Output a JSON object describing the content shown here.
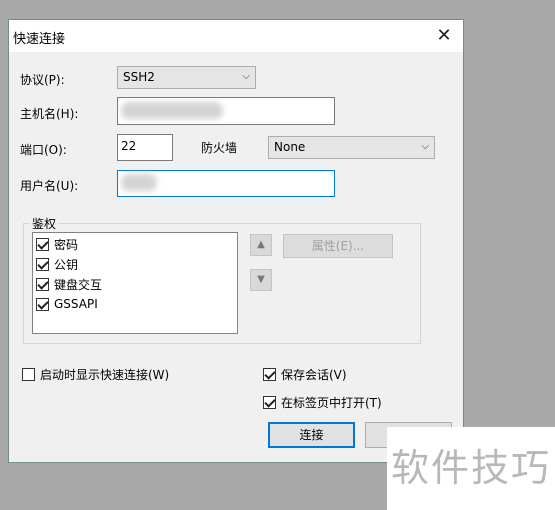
{
  "dialog": {
    "title": "快速连接",
    "close_glyph": "✕"
  },
  "protocol": {
    "label": "协议(P):",
    "value": "SSH2"
  },
  "hostname": {
    "label": "主机名(H):",
    "value": ""
  },
  "port": {
    "label": "端口(O):",
    "value": "22"
  },
  "firewall": {
    "label": "防火墙",
    "value": "None"
  },
  "username": {
    "label": "用户名(U):",
    "value": ""
  },
  "auth": {
    "label": "鉴权",
    "methods": [
      {
        "label": "密码",
        "checked": true
      },
      {
        "label": "公钥",
        "checked": true
      },
      {
        "label": "键盘交互",
        "checked": true
      },
      {
        "label": "GSSAPI",
        "checked": true
      }
    ],
    "up_glyph": "▲",
    "down_glyph": "▼",
    "properties_label": "属性(E)..."
  },
  "options": {
    "show_on_startup": {
      "label": "启动时显示快速连接(W)",
      "checked": false
    },
    "save_session": {
      "label": "保存会话(V)",
      "checked": true
    },
    "open_in_tab": {
      "label": "在标签页中打开(T)",
      "checked": true
    }
  },
  "buttons": {
    "connect": "连接",
    "cancel": ""
  },
  "watermark": "软件技巧"
}
